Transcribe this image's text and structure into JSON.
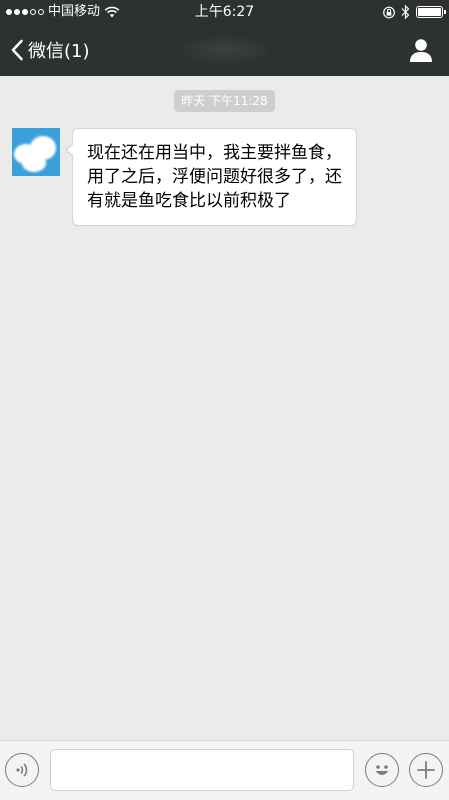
{
  "status_bar": {
    "carrier": "中国移动",
    "time": "上午6:27",
    "signal_bars_filled": 3,
    "signal_bars_total": 5,
    "battery_level": 1.0,
    "icons": [
      "wifi-icon",
      "orientation-lock-icon",
      "bluetooth-icon",
      "battery-icon"
    ]
  },
  "nav": {
    "back_label": "微信(1)",
    "back_icon": "chevron-left-icon",
    "profile_icon": "person-icon"
  },
  "chat": {
    "timestamp": "昨天 下午11:28",
    "messages": [
      {
        "direction": "incoming",
        "text": "现在还在用当中，我主要拌鱼食，用了之后，浮便问题好很多了，还有就是鱼吃食比以前积极了"
      }
    ]
  },
  "input_bar": {
    "voice_icon": "voice-icon",
    "emoji_icon": "emoji-icon",
    "plus_icon": "plus-icon",
    "input_value": ""
  },
  "colors": {
    "nav_background": "#2e3132",
    "chat_background": "#ebebeb",
    "avatar_color": "#3aa0dc"
  }
}
